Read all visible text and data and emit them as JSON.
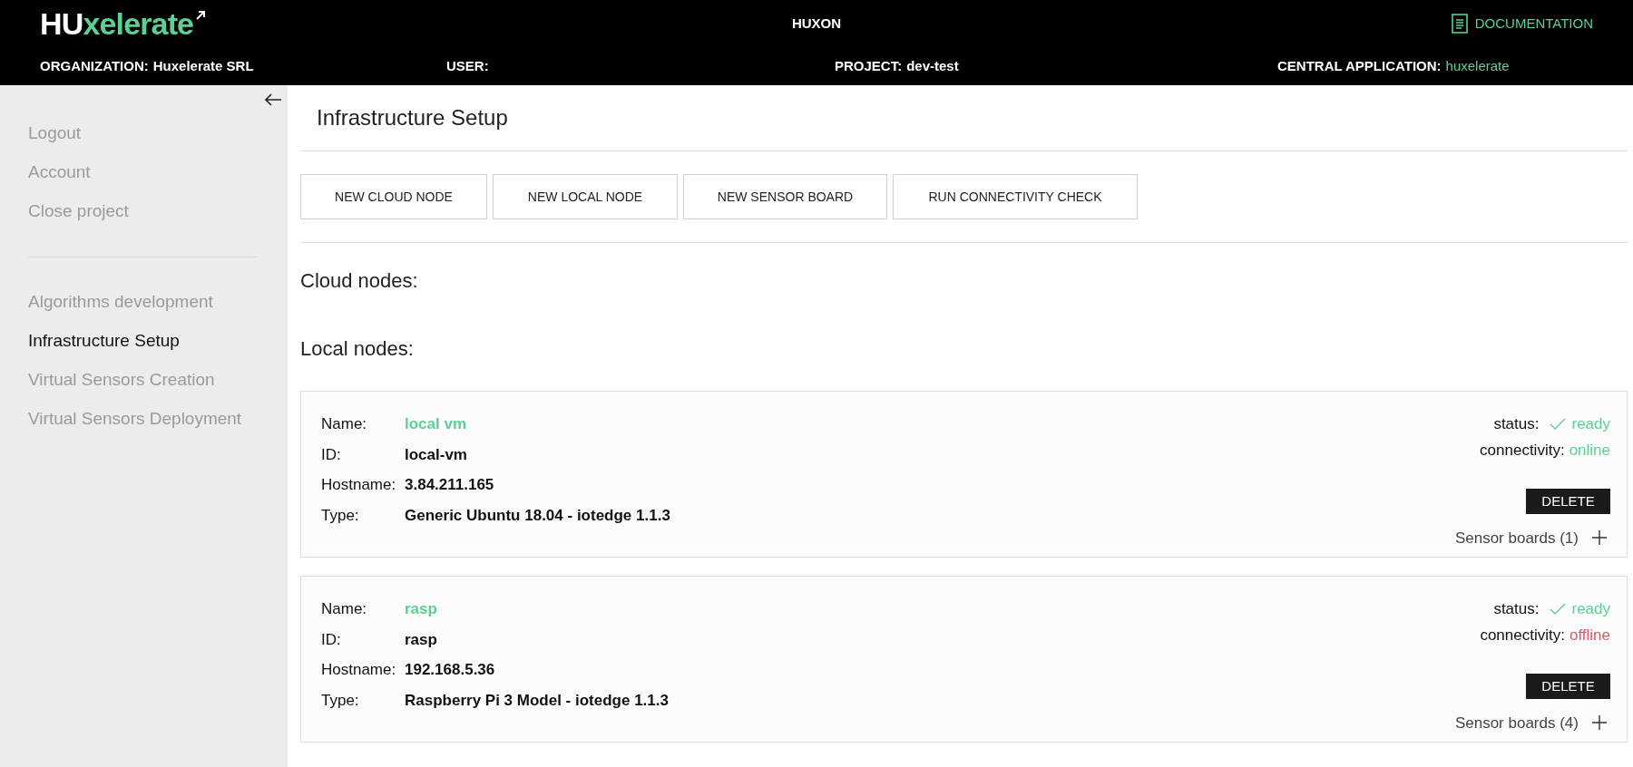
{
  "header": {
    "logo_prefix": "HU",
    "logo_suffix": "xelerate",
    "app_name": "HUXON",
    "documentation": "DOCUMENTATION",
    "info": [
      {
        "label": "ORGANIZATION:",
        "value": "Huxelerate SRL",
        "highlight": false
      },
      {
        "label": "USER:"
      },
      {
        "label": "PROJECT:",
        "value": "dev-test",
        "highlight": false
      },
      {
        "label": "CENTRAL APPLICATION:",
        "value": "huxelerate",
        "highlight": true
      }
    ]
  },
  "sidebar": {
    "groups": [
      [
        {
          "label": "Logout",
          "selected": false
        },
        {
          "label": "Account",
          "selected": false
        },
        {
          "label": "Close project",
          "selected": false
        }
      ],
      [
        {
          "label": "Algorithms development",
          "selected": false
        },
        {
          "label": "Infrastructure Setup",
          "selected": true
        },
        {
          "label": "Virtual Sensors Creation",
          "selected": false
        },
        {
          "label": "Virtual Sensors Deployment",
          "selected": false
        }
      ]
    ]
  },
  "page_title": "Infrastructure Setup",
  "actions": [
    "NEW CLOUD NODE",
    "NEW LOCAL NODE",
    "NEW SENSOR BOARD",
    "RUN CONNECTIVITY CHECK"
  ],
  "cloud_nodes": {
    "heading": "Cloud nodes:"
  },
  "local_nodes": {
    "heading": "Local nodes:",
    "nodes": [
      {
        "fields": [
          {
            "label": "Name:",
            "value": "local vm",
            "kind": "name"
          },
          {
            "label": "ID:",
            "value": "local-vm",
            "kind": "plain"
          },
          {
            "label": "Hostname:",
            "value": "3.84.211.165",
            "kind": "plain"
          },
          {
            "label": "Type:",
            "value": "Generic Ubuntu 18.04 - iotedge 1.1.3",
            "kind": "plain"
          }
        ],
        "status_label": "status:",
        "status": "ready",
        "connectivity_label": "connectivity:",
        "connectivity": "online",
        "online": true,
        "delete": "DELETE",
        "sensor_boards": "Sensor boards (1)"
      },
      {
        "fields": [
          {
            "label": "Name:",
            "value": "rasp",
            "kind": "name"
          },
          {
            "label": "ID:",
            "value": "rasp",
            "kind": "plain"
          },
          {
            "label": "Hostname:",
            "value": "192.168.5.36",
            "kind": "plain"
          },
          {
            "label": "Type:",
            "value": "Raspberry Pi 3 Model - iotedge 1.1.3",
            "kind": "plain"
          }
        ],
        "status_label": "status:",
        "status": "ready",
        "connectivity_label": "connectivity:",
        "connectivity": "offline",
        "online": false,
        "delete": "DELETE",
        "sensor_boards": "Sensor boards (4)"
      }
    ]
  }
}
